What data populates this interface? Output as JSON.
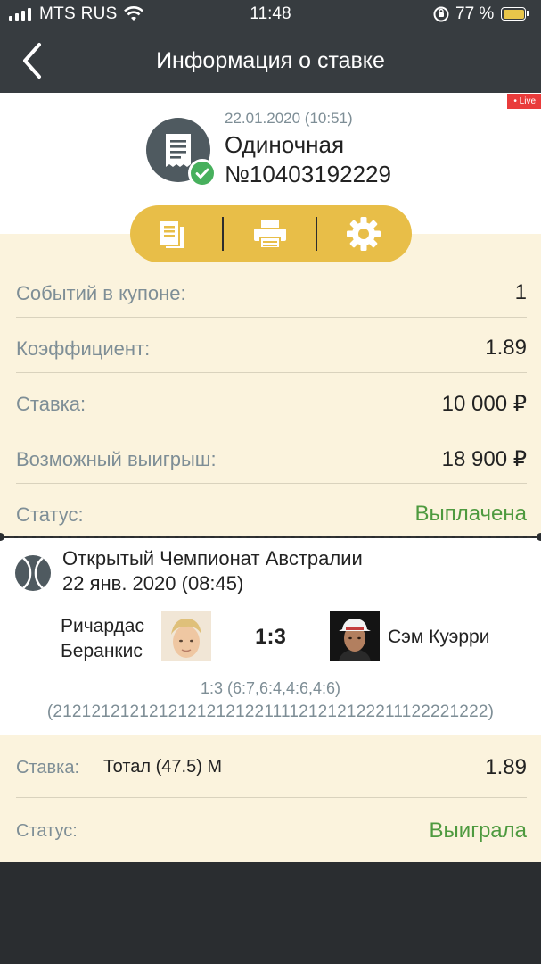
{
  "status_bar": {
    "carrier": "MTS RUS",
    "time": "11:48",
    "battery": "77 %",
    "icons": [
      "signal-icon",
      "wifi-icon",
      "rotation-lock-icon",
      "battery-charging-icon"
    ]
  },
  "header": {
    "title": "Информация о ставке",
    "back_icon": "chevron-left-icon"
  },
  "bet": {
    "live_badge": "• Live",
    "datetime": "22.01.2020 (10:51)",
    "type": "Одиночная",
    "number": "№10403192229",
    "icon": "receipt-check-icon"
  },
  "actions": [
    {
      "name": "copy-document-icon"
    },
    {
      "name": "print-icon"
    },
    {
      "name": "gear-icon"
    }
  ],
  "summary": {
    "events_label": "Событий в купоне:",
    "events_value": "1",
    "coef_label": "Коэффициент:",
    "coef_value": "1.89",
    "stake_label": "Ставка:",
    "stake_value": "10 000 ₽",
    "win_label": "Возможный выигрыш:",
    "win_value": "18 900 ₽",
    "status_label": "Статус:",
    "status_value": "Выплачена"
  },
  "event": {
    "tournament": "Открытый Чемпионат Австралии",
    "date": "22 янв. 2020 (08:45)",
    "player1_line1": "Ричардас",
    "player1_line2": "Беранкис",
    "player2": "Сэм Куэрри",
    "score": "1:3",
    "sets": "1:3 (6:7,6:4,4:6,4:6)",
    "games": "(2121212121212121212122111121212122211122221222)"
  },
  "pick": {
    "stake_label": "Ставка:",
    "market": "Тотал (47.5) М",
    "coef": "1.89",
    "status_label": "Статус:",
    "status_value": "Выиграла"
  },
  "colors": {
    "header_bg": "#373c40",
    "cream": "#fbf3dd",
    "pill": "#e8be48",
    "green": "#4e9a3f",
    "label_gray": "#7e8e96",
    "live_red": "#e93b3b"
  }
}
